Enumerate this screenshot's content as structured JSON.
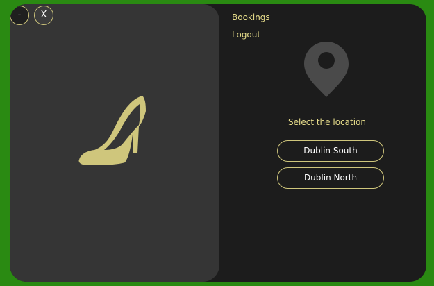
{
  "window_controls": {
    "minimize_label": "-",
    "close_label": "X"
  },
  "illustration": {
    "icon": "high-heel-shoe-icon",
    "color": "#cfc67c"
  },
  "nav": {
    "bookings_label": "Bookings",
    "logout_label": "Logout"
  },
  "location": {
    "icon": "map-pin-icon",
    "prompt": "Select the location",
    "options": [
      "Dublin South",
      "Dublin North"
    ]
  },
  "colors": {
    "background": "#2a8a12",
    "window": "#1c1c1c",
    "left_panel": "#353535",
    "accent": "#e6dc8a",
    "button_border": "#cfc67c"
  }
}
